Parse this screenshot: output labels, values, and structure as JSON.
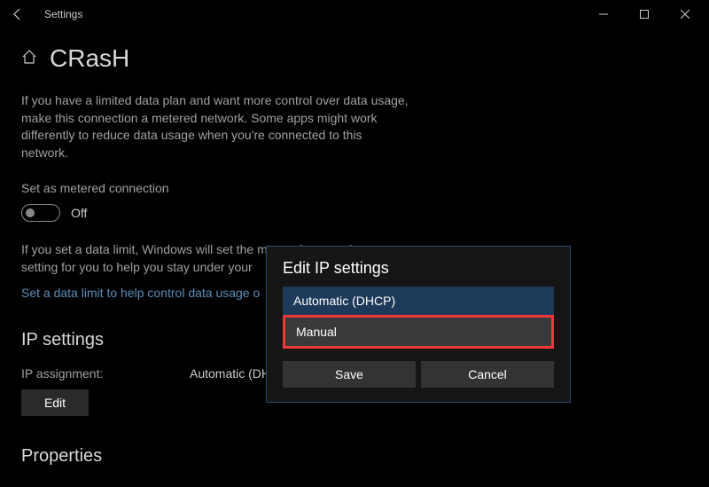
{
  "titlebar": {
    "app": "Settings"
  },
  "page": {
    "title": "CRasH",
    "description": "If you have a limited data plan and want more control over data usage, make this connection a metered network. Some apps might work differently to reduce data usage when you're connected to this network.",
    "toggle_label": "Set as metered connection",
    "toggle_state": "Off",
    "limit_text": "If you set a data limit, Windows will set the metered connection setting for you to help you stay under your",
    "link_text": "Set a data limit to help control data usage o"
  },
  "ip": {
    "section": "IP settings",
    "assignment_label": "IP assignment:",
    "assignment_value": "Automatic (DHC",
    "edit_label": "Edit"
  },
  "props": {
    "section": "Properties"
  },
  "dialog": {
    "title": "Edit IP settings",
    "option1": "Automatic (DHCP)",
    "option2": "Manual",
    "save": "Save",
    "cancel": "Cancel"
  }
}
